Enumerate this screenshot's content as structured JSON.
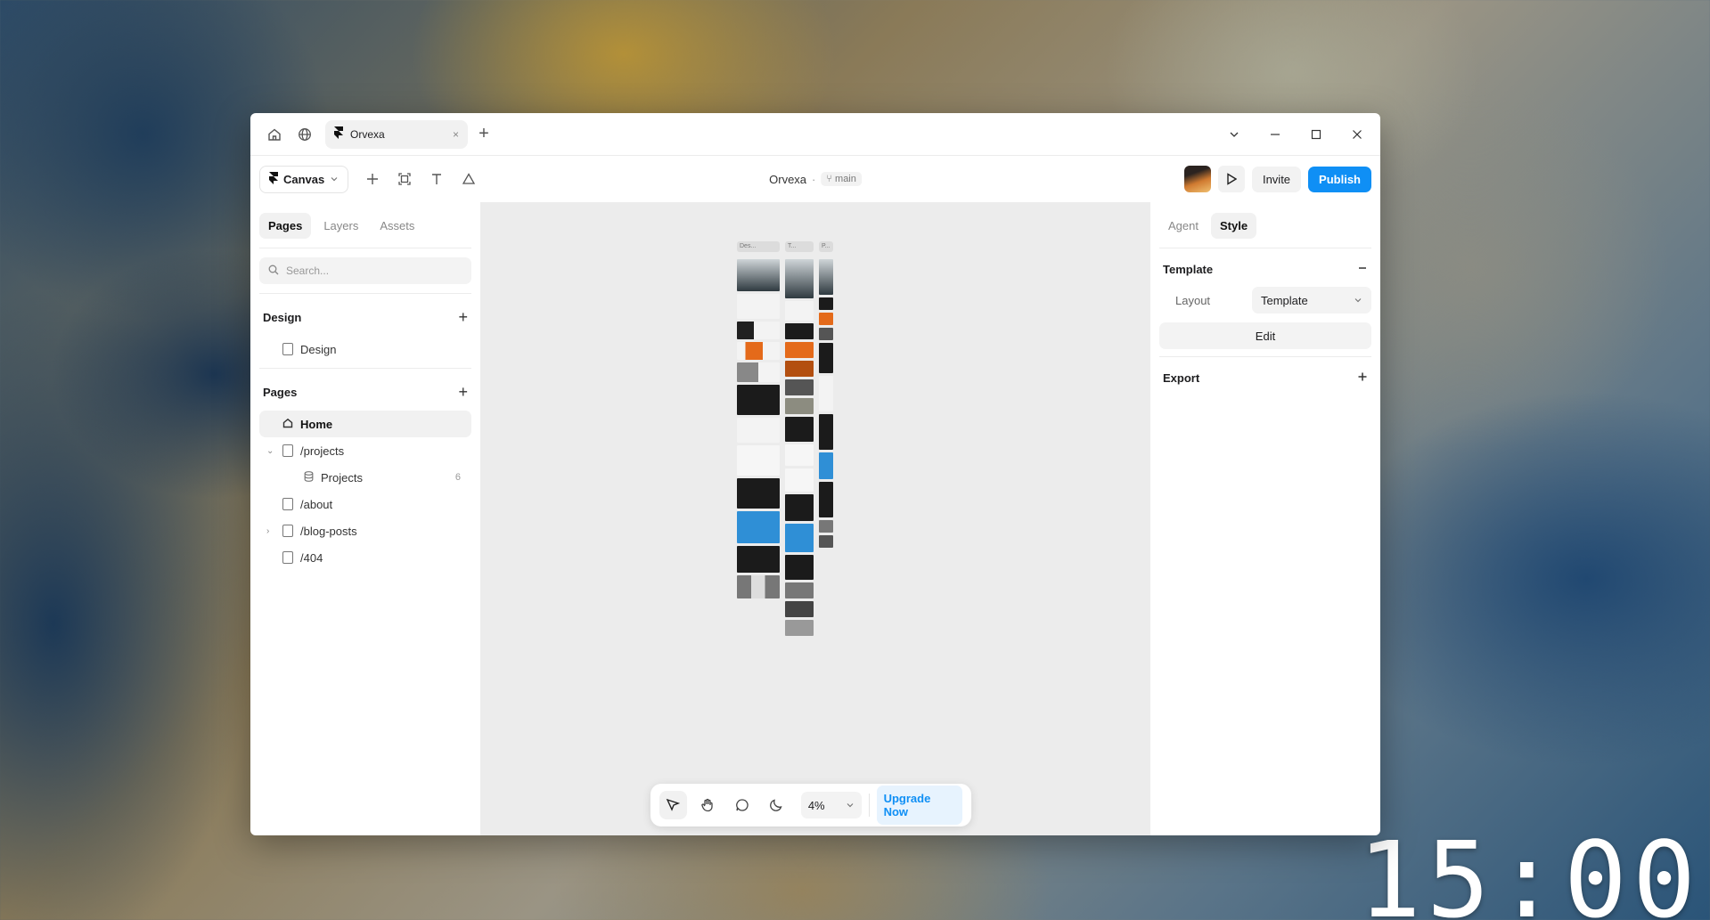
{
  "window": {
    "tab_title": "Orvexa",
    "tab_close": "×",
    "new_tab": "+"
  },
  "toolbar": {
    "canvas_label": "Canvas",
    "project_name": "Orvexa",
    "separator": "·",
    "branch": "main",
    "invite_label": "Invite",
    "publish_label": "Publish"
  },
  "sidebar": {
    "tabs": [
      {
        "label": "Pages"
      },
      {
        "label": "Layers"
      },
      {
        "label": "Assets"
      }
    ],
    "search_placeholder": "Search...",
    "design_section": {
      "title": "Design",
      "items": [
        {
          "label": "Design"
        }
      ]
    },
    "pages_section": {
      "title": "Pages",
      "items": [
        {
          "label": "Home"
        },
        {
          "label": "/projects"
        },
        {
          "label": "Projects",
          "count": "6"
        },
        {
          "label": "/about"
        },
        {
          "label": "/blog-posts"
        },
        {
          "label": "/404"
        }
      ]
    }
  },
  "canvas": {
    "thumb_labels": [
      "Des...",
      "T...",
      "P..."
    ],
    "zoom": "4%",
    "upgrade_label": "Upgrade Now"
  },
  "right_panel": {
    "tabs": [
      {
        "label": "Agent"
      },
      {
        "label": "Style"
      }
    ],
    "template": {
      "title": "Template",
      "layout_label": "Layout",
      "layout_value": "Template",
      "edit_label": "Edit"
    },
    "export": {
      "title": "Export"
    }
  },
  "desktop": {
    "clock": "15:00"
  },
  "colors": {
    "accent": "#0f8ff5",
    "accent_light": "#e7f3fe"
  }
}
